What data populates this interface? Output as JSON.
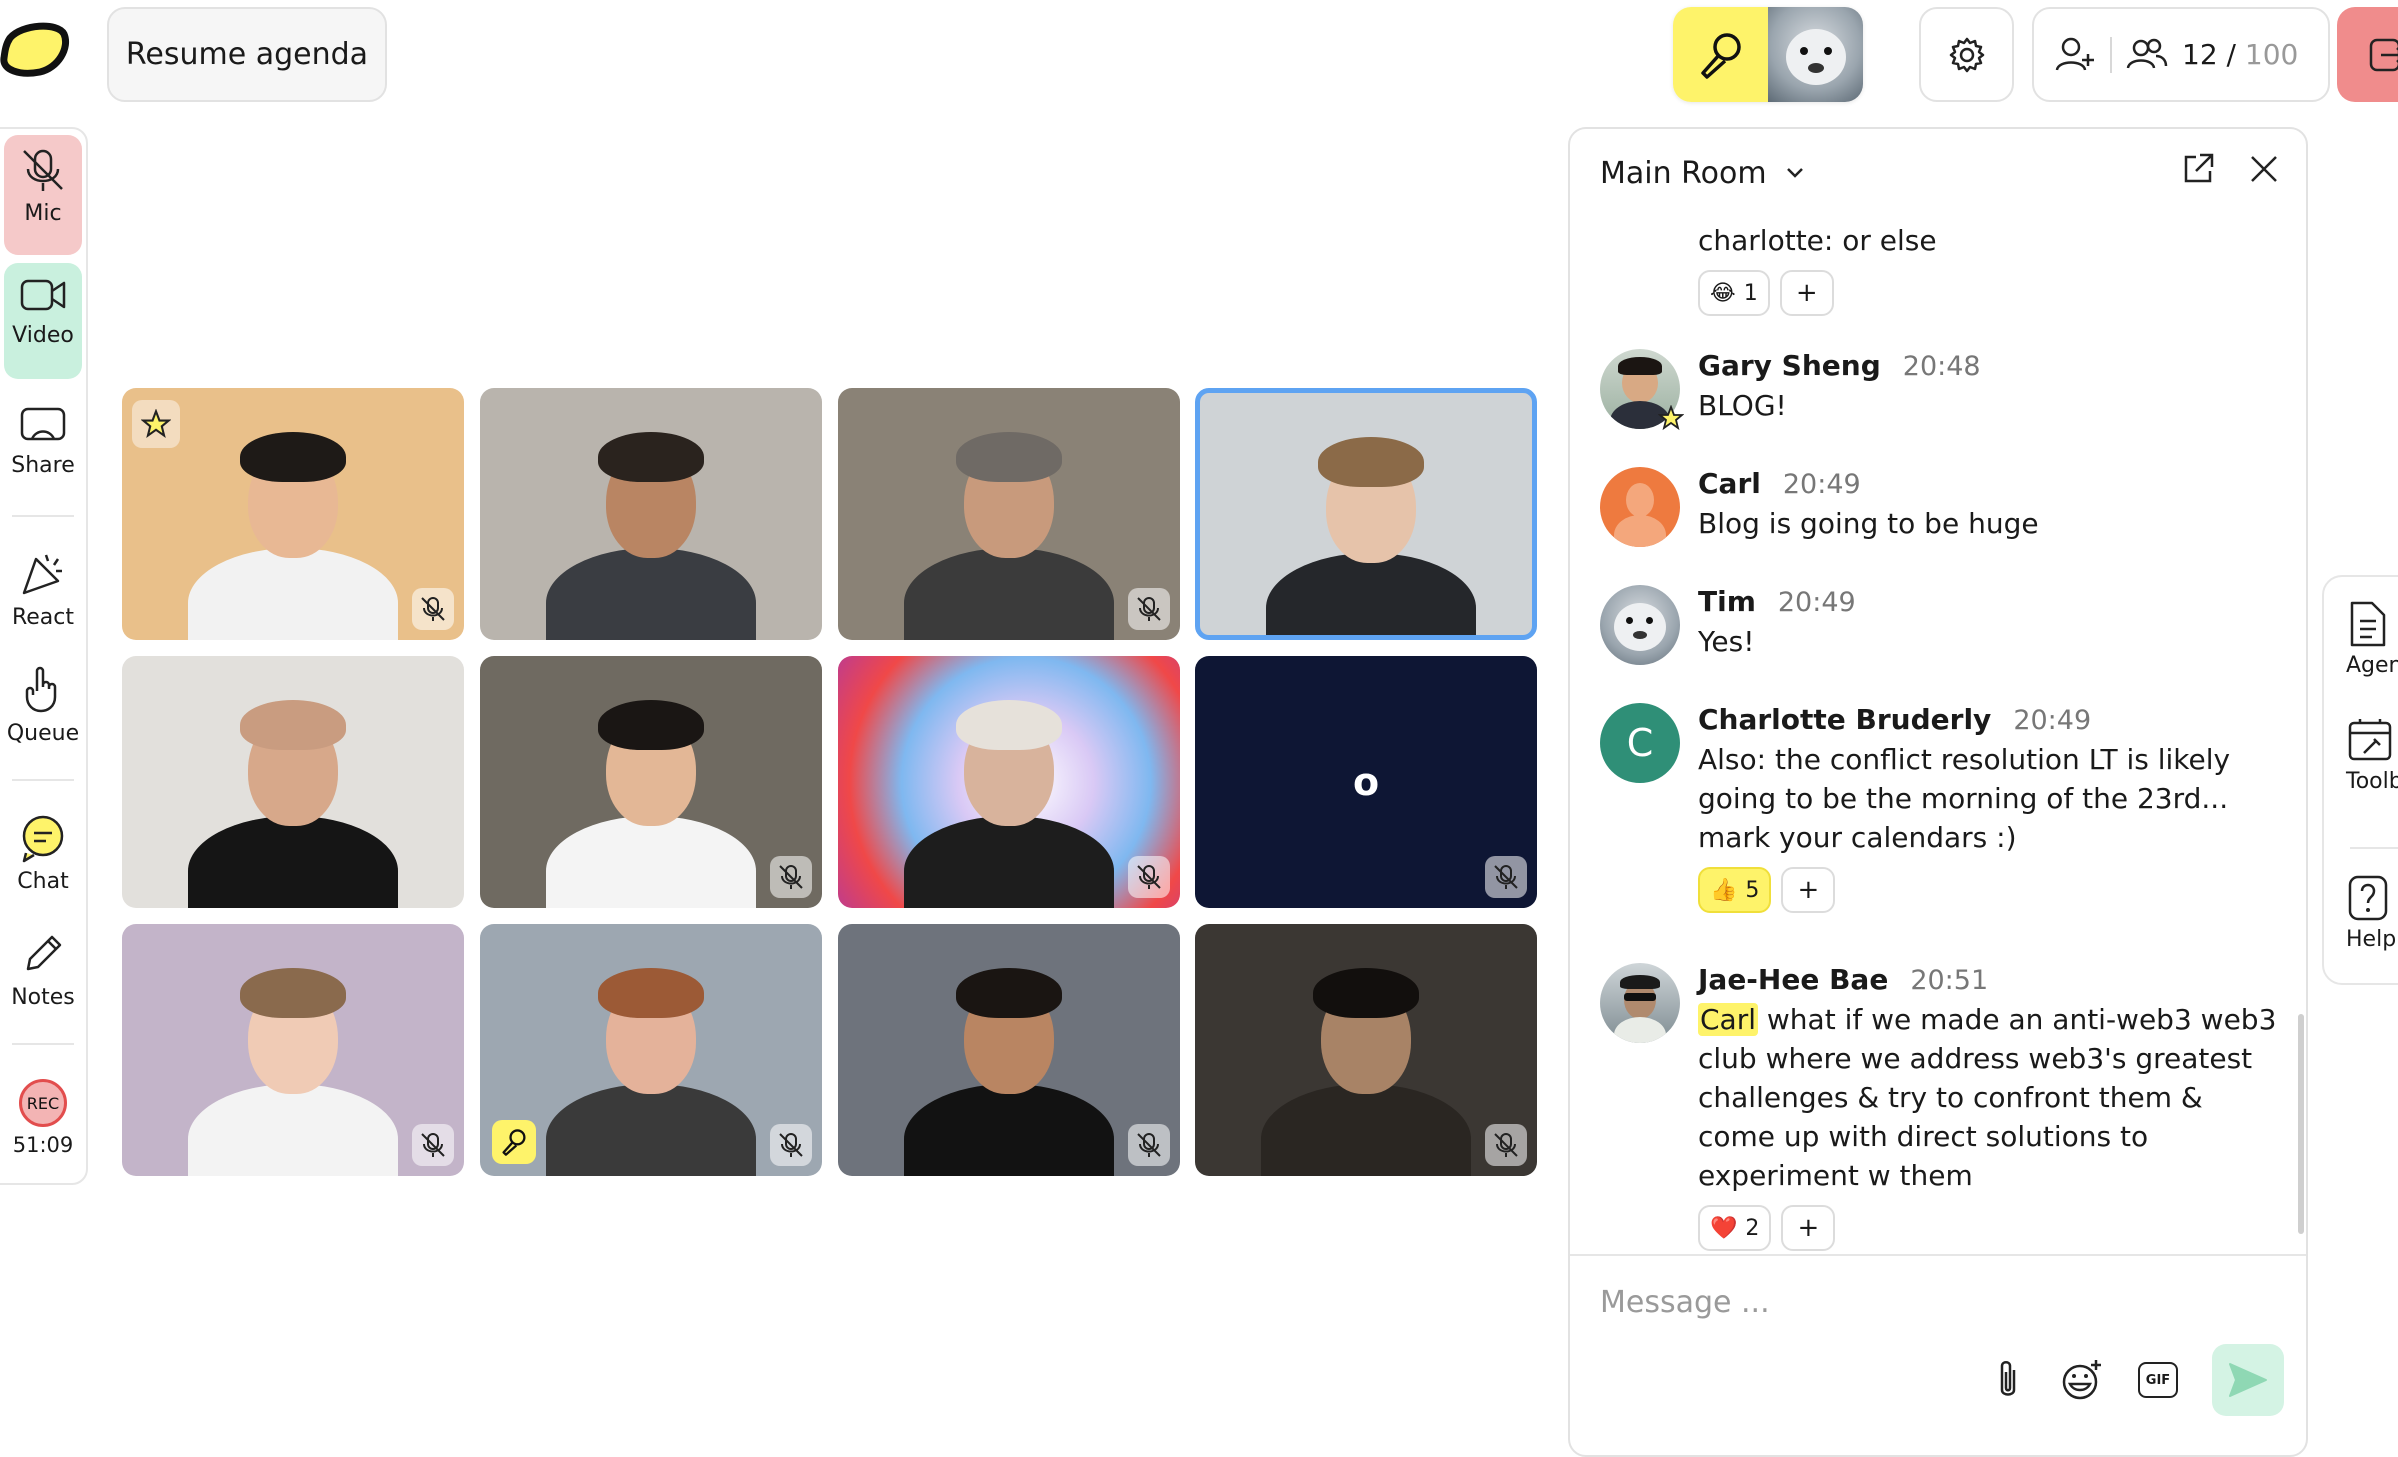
{
  "top_bar": {
    "resume_label": "Resume agenda",
    "people_count": "12",
    "people_separator": " / ",
    "people_max": "100"
  },
  "left_rail": {
    "mic": "Mic",
    "video": "Video",
    "share": "Share",
    "react": "React",
    "queue": "Queue",
    "chat": "Chat",
    "notes": "Notes",
    "rec_badge": "REC",
    "rec_time": "51:09"
  },
  "grid": {
    "tiles": [
      {
        "bg": "#e9c08a",
        "face": "#e8b894",
        "hair": "#1e1a17",
        "shirt": "#f2f2f2",
        "muted": true,
        "star": true
      },
      {
        "bg": "#b9b4ad",
        "face": "#b98563",
        "hair": "#2a231e",
        "shirt": "#3a3d42",
        "muted": false
      },
      {
        "bg": "#8a8276",
        "face": "#c89a7c",
        "hair": "#6f6a65",
        "shirt": "#3b3b3b",
        "muted": true
      },
      {
        "bg": "#cfd3d6",
        "face": "#e6c3aa",
        "hair": "#8b6a48",
        "shirt": "#25272b",
        "muted": false,
        "active": true
      },
      {
        "bg": "#e2e0dc",
        "face": "#d7a88a",
        "hair": "#c99c80",
        "shirt": "#151515",
        "muted": false
      },
      {
        "bg": "#6f6a61",
        "face": "#e3b796",
        "hair": "#1a1614",
        "shirt": "#f4f4f4",
        "muted": true
      },
      {
        "bg": "#c9b9e6",
        "face": "#d8b39c",
        "hair": "#e6e1da",
        "shirt": "#1d1d1d",
        "muted": true,
        "rainbow": true
      },
      {
        "bg": "#0e1634",
        "initial": "o",
        "muted": true
      },
      {
        "bg": "#c3b4c9",
        "face": "#f0cbb5",
        "hair": "#8a6a4d",
        "shirt": "#f3f3f3",
        "muted": true
      },
      {
        "bg": "#9da7b1",
        "face": "#e4b29a",
        "hair": "#9c5a36",
        "shirt": "#3a3a3a",
        "muted": true,
        "speaking": true
      },
      {
        "bg": "#6e737c",
        "face": "#b98562",
        "hair": "#1a1512",
        "shirt": "#121212",
        "muted": true
      },
      {
        "bg": "#3b3733",
        "face": "#a88366",
        "hair": "#120f0d",
        "shirt": "#2a2622",
        "muted": true
      }
    ]
  },
  "chat": {
    "room_name": "Main Room",
    "messages": [
      {
        "id": "m0",
        "text": "charlotte: or else",
        "reactions": [
          {
            "emoji": "😂",
            "count": "1"
          }
        ]
      },
      {
        "id": "m1",
        "name": "Gary Sheng",
        "time": "20:48",
        "text": "BLOG!"
      },
      {
        "id": "m2",
        "name": "Carl",
        "time": "20:49",
        "text": "Blog is going to be huge"
      },
      {
        "id": "m3",
        "name": "Tim",
        "time": "20:49",
        "text": "Yes!"
      },
      {
        "id": "m4",
        "name": "Charlotte Bruderly",
        "time": "20:49",
        "initial": "C",
        "text": "Also: the conflict resolution LT is likely going to be the morning of the 23rd... mark your calendars :)",
        "reactions": [
          {
            "emoji": "👍",
            "count": "5",
            "hot": true
          }
        ]
      },
      {
        "id": "m5",
        "name": "Jae-Hee Bae",
        "time": "20:51",
        "mention": "Carl",
        "text": " what if we made an anti-web3 web3 club where we address web3's greatest challenges & try to confront them & come up with direct solutions to experiment w them",
        "reactions": [
          {
            "emoji": "❤️",
            "count": "2"
          }
        ]
      }
    ],
    "composer_placeholder": "Message ...",
    "gif_label": "GIF",
    "add_reaction": "+"
  },
  "right_rail": {
    "agenda": "Agenda",
    "toolbox": "Toolbox",
    "help": "Help"
  }
}
